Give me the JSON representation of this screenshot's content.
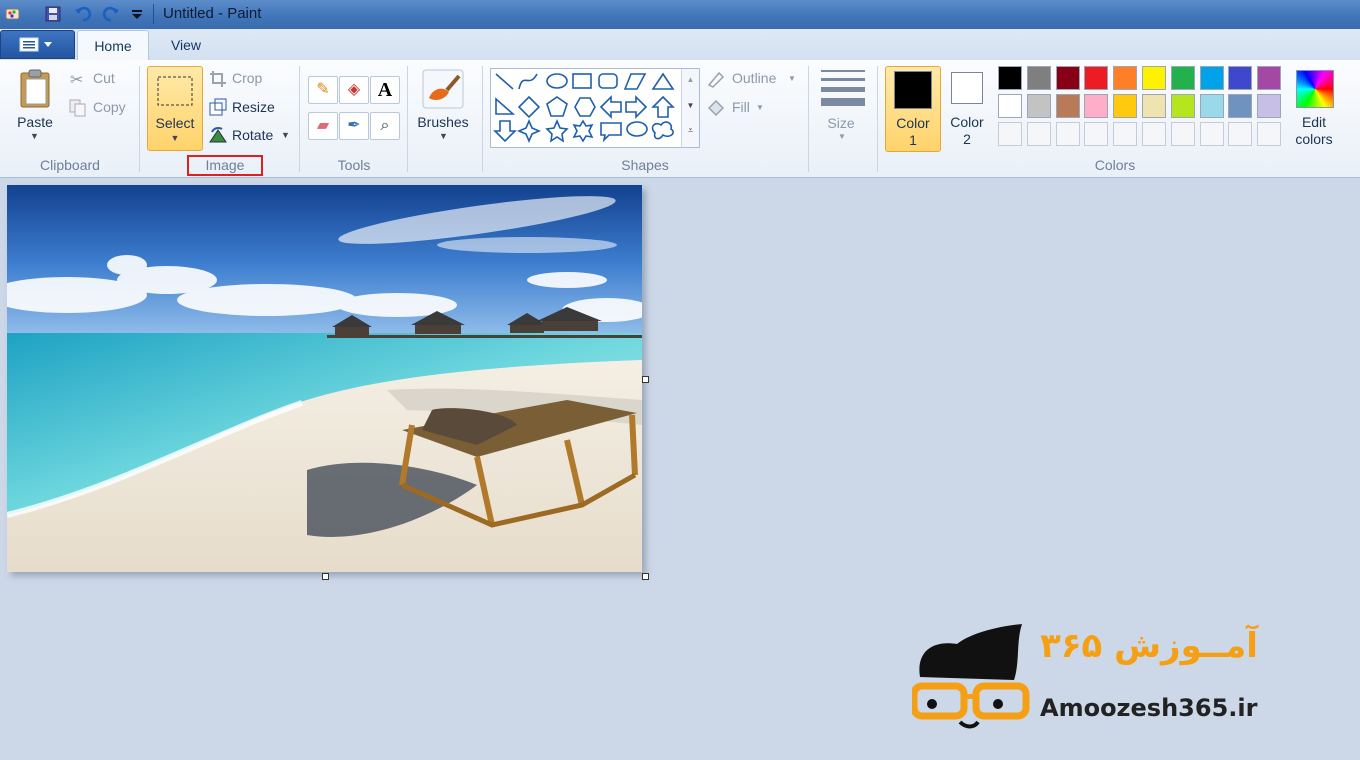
{
  "window": {
    "title": "Untitled - Paint"
  },
  "tabs": [
    {
      "label": "Home"
    },
    {
      "label": "View"
    }
  ],
  "clipboard": {
    "paste": "Paste",
    "cut": "Cut",
    "copy": "Copy",
    "group": "Clipboard"
  },
  "image": {
    "select": "Select",
    "crop": "Crop",
    "resize": "Resize",
    "rotate": "Rotate",
    "group": "Image"
  },
  "tools": {
    "group": "Tools"
  },
  "brushes": {
    "label": "Brushes"
  },
  "shapes": {
    "outline": "Outline",
    "fill": "Fill",
    "group": "Shapes"
  },
  "size": {
    "label": "Size"
  },
  "colors": {
    "color1": "Color 1",
    "color2": "Color 2",
    "edit": "Edit colors",
    "group": "Colors",
    "color1_value": "#000000",
    "color2_value": "#ffffff",
    "row1": [
      "#000000",
      "#7f7f7f",
      "#880015",
      "#ed1c24",
      "#ff7f27",
      "#fff200",
      "#22b14c",
      "#00a2e8",
      "#3f48cc",
      "#a349a4"
    ],
    "row2": [
      "#ffffff",
      "#c3c3c3",
      "#b97a57",
      "#ffaec9",
      "#ffc90e",
      "#efe4b0",
      "#b5e61d",
      "#99d9ea",
      "#7092be",
      "#c8bfe7"
    ]
  },
  "watermark": {
    "site": "Amoozesh365.ir",
    "fa": "آمــوزش ۳۶۵"
  }
}
